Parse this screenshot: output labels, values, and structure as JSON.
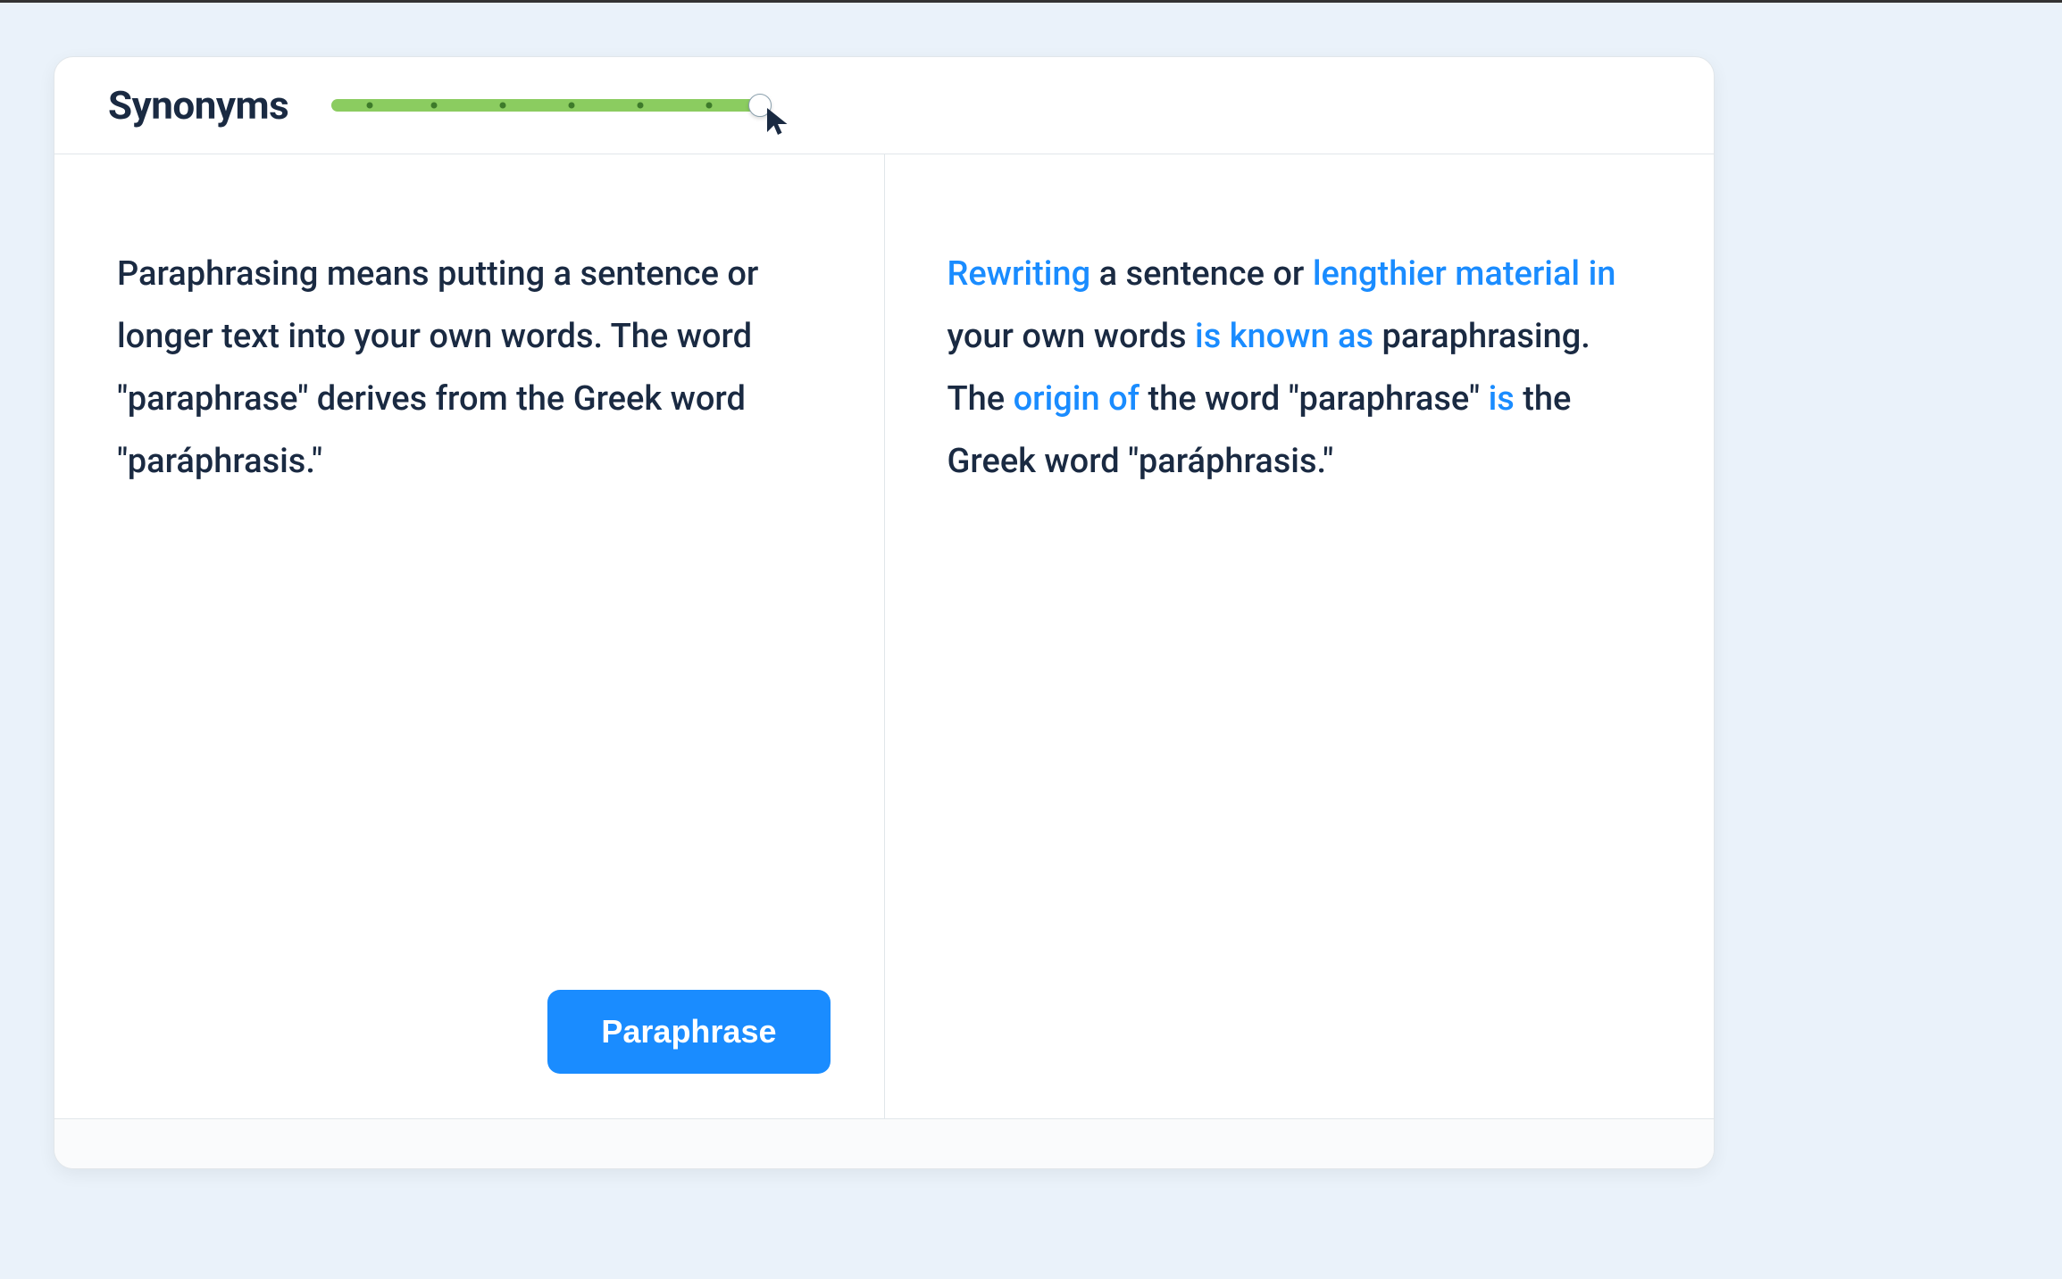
{
  "header": {
    "title": "Synonyms",
    "slider": {
      "steps": 7,
      "value": 7,
      "dot_positions_pct": [
        9,
        24,
        40,
        56,
        72,
        88
      ]
    }
  },
  "input": {
    "text": "Paraphrasing means putting a sentence or longer text into your own words. The word \"paraphrase\" derives from the Greek word \"paráphrasis.\"",
    "button_label": "Paraphrase"
  },
  "output": {
    "segments": [
      {
        "text": "Rewriting",
        "hl": true
      },
      {
        "text": " a sentence or ",
        "hl": false
      },
      {
        "text": "lengthier material in",
        "hl": true
      },
      {
        "text": " your own words ",
        "hl": false
      },
      {
        "text": "is known as",
        "hl": true
      },
      {
        "text": " paraphrasing. The ",
        "hl": false
      },
      {
        "text": "origin of",
        "hl": true
      },
      {
        "text": " the word \"paraphrase\" ",
        "hl": false
      },
      {
        "text": "is",
        "hl": true
      },
      {
        "text": " the Greek word \"paráphrasis.\"",
        "hl": false
      }
    ]
  },
  "colors": {
    "accent": "#1a8cff",
    "slider_fill": "#8bcc60",
    "slider_dot": "#3d7a2a",
    "text": "#1a2a42",
    "page_bg": "#eaf2fa"
  }
}
